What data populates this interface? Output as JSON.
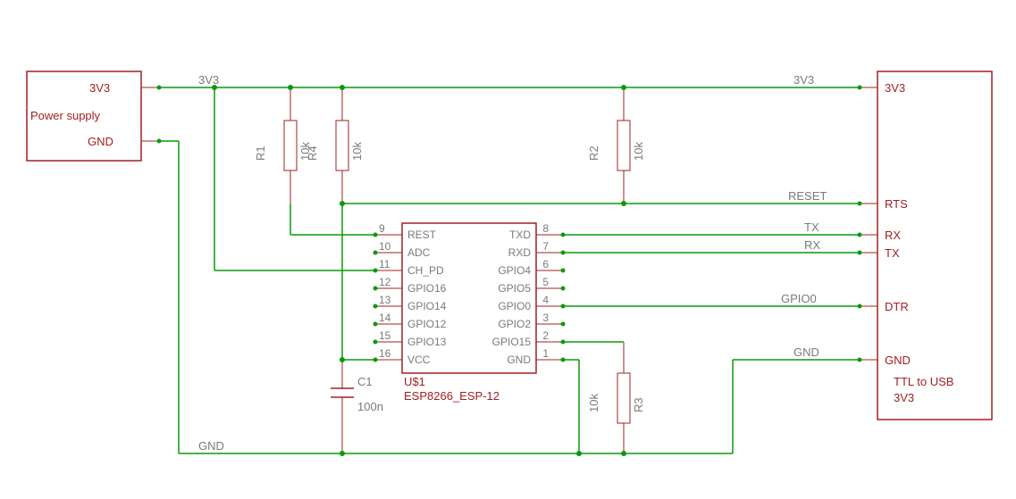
{
  "power_supply": {
    "title": "Power supply",
    "pin3v3": "3V3",
    "pinGnd": "GND"
  },
  "ttl_usb": {
    "title": "TTL to USB",
    "sub": "3V3",
    "pin3v3": "3V3",
    "pinRts": "RTS",
    "pinRx": "RX",
    "pinTx": "TX",
    "pinDtr": "DTR",
    "pinGnd": "GND"
  },
  "nets": {
    "v3_left": "3V3",
    "v3_right": "3V3",
    "gnd_left": "GND",
    "gnd_right": "GND",
    "reset": "RESET",
    "tx": "TX",
    "rx": "RX",
    "gpio0": "GPIO0"
  },
  "resistors": {
    "r1": {
      "name": "R1",
      "value": "10k"
    },
    "r2": {
      "name": "R2",
      "value": "10k"
    },
    "r3": {
      "name": "R3",
      "value": "10k"
    },
    "r4": {
      "name": "R4",
      "value": "10k"
    }
  },
  "cap": {
    "name": "C1",
    "value": "100n"
  },
  "ic": {
    "ref": "U$1",
    "part": "ESP8266_ESP-12",
    "pins_left": [
      {
        "num": "9",
        "name": "REST"
      },
      {
        "num": "10",
        "name": "ADC"
      },
      {
        "num": "11",
        "name": "CH_PD"
      },
      {
        "num": "12",
        "name": "GPIO16"
      },
      {
        "num": "13",
        "name": "GPIO14"
      },
      {
        "num": "14",
        "name": "GPIO12"
      },
      {
        "num": "15",
        "name": "GPIO13"
      },
      {
        "num": "16",
        "name": "VCC"
      }
    ],
    "pins_right": [
      {
        "num": "8",
        "name": "TXD"
      },
      {
        "num": "7",
        "name": "RXD"
      },
      {
        "num": "6",
        "name": "GPIO4"
      },
      {
        "num": "5",
        "name": "GPIO5"
      },
      {
        "num": "4",
        "name": "GPIO0"
      },
      {
        "num": "3",
        "name": "GPIO2"
      },
      {
        "num": "2",
        "name": "GPIO15"
      },
      {
        "num": "1",
        "name": "GND"
      }
    ]
  }
}
